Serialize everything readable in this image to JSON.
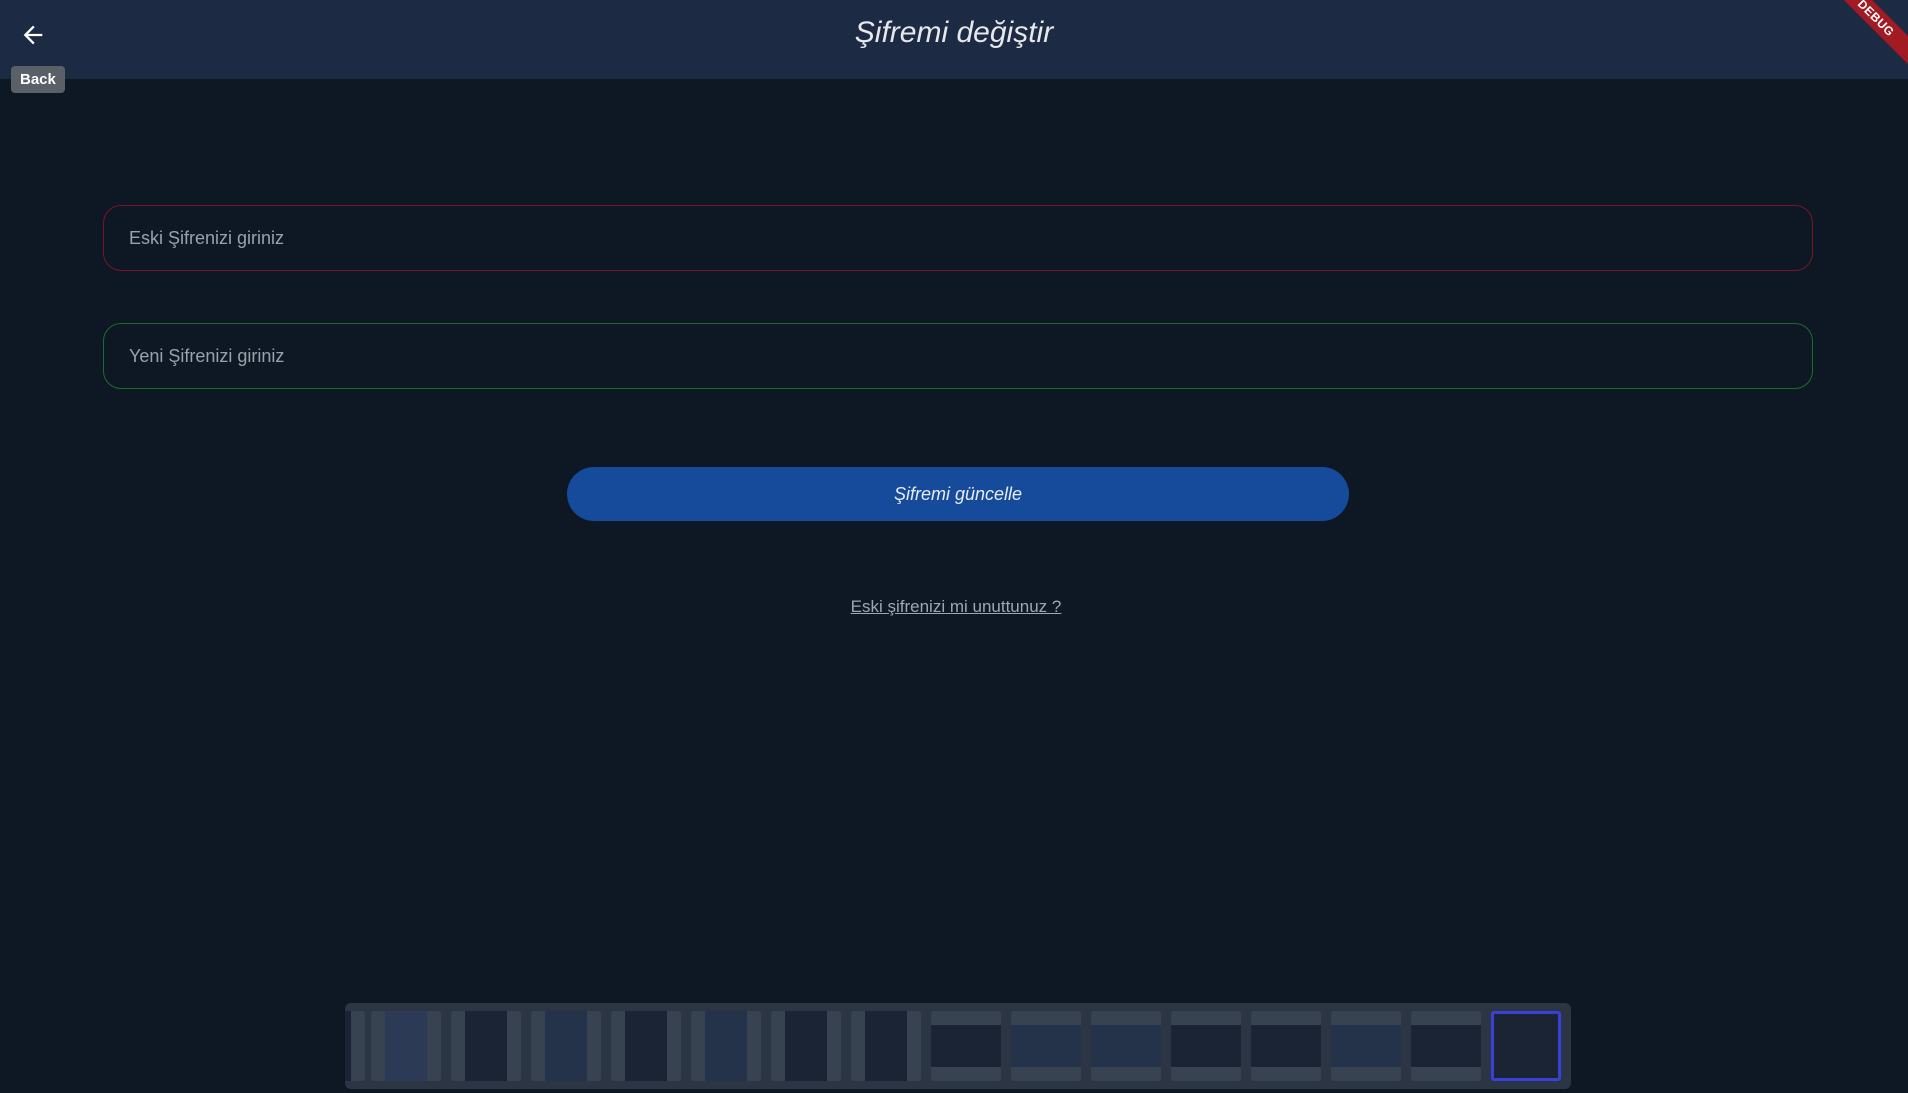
{
  "app_bar": {
    "title": "Şifremi değiştir",
    "back_tooltip": "Back",
    "debug_banner": "DEBUG"
  },
  "form": {
    "old_password_placeholder": "Eski Şifrenizi giriniz",
    "new_password_placeholder": "Yeni Şifrenizi giriniz",
    "update_button_label": "Şifremi güncelle",
    "forgot_link": "Eski şifrenizi mi unuttunuz ?"
  },
  "colors": {
    "app_bar_bg": "#1c2a44",
    "page_bg": "#0d1824",
    "old_field_border": "#7a1424",
    "new_field_border": "#1d6b2c",
    "button_bg": "#164a9b",
    "debug_banner": "#a31b22"
  },
  "thumbnail_strip": {
    "count": 16,
    "selected_index": 15
  }
}
